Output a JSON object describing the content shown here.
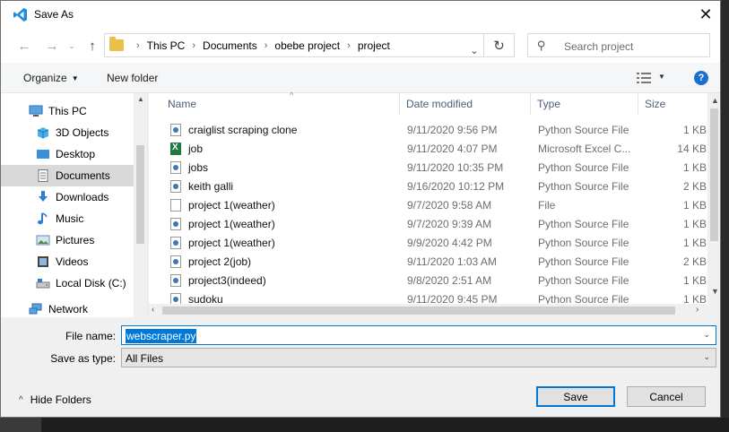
{
  "window": {
    "title": "Save As",
    "close_glyph": "✕"
  },
  "nav": {
    "back_glyph": "←",
    "forward_glyph": "→",
    "up_glyph": "↑",
    "breadcrumb": [
      "This PC",
      "Documents",
      "obebe project",
      "project"
    ],
    "refresh_glyph": "↻",
    "search_placeholder": "Search project"
  },
  "toolbar": {
    "organize": "Organize",
    "new_folder": "New folder",
    "help": "?"
  },
  "sidebar": {
    "items": [
      {
        "label": "This PC",
        "icon": "computer-icon"
      },
      {
        "label": "3D Objects",
        "icon": "3d-objects-icon"
      },
      {
        "label": "Desktop",
        "icon": "desktop-icon"
      },
      {
        "label": "Documents",
        "icon": "documents-icon",
        "selected": true
      },
      {
        "label": "Downloads",
        "icon": "downloads-icon"
      },
      {
        "label": "Music",
        "icon": "music-icon"
      },
      {
        "label": "Pictures",
        "icon": "pictures-icon"
      },
      {
        "label": "Videos",
        "icon": "videos-icon"
      },
      {
        "label": "Local Disk (C:)",
        "icon": "local-disk-icon"
      },
      {
        "label": "Network",
        "icon": "network-icon"
      }
    ]
  },
  "files": {
    "columns": {
      "name": "Name",
      "date": "Date modified",
      "type": "Type",
      "size": "Size"
    },
    "rows": [
      {
        "name": "craiglist scraping clone",
        "date": "9/11/2020 9:56 PM",
        "type": "Python Source File",
        "size": "1 KB",
        "icon": "python-file-icon"
      },
      {
        "name": "job",
        "date": "9/11/2020 4:07 PM",
        "type": "Microsoft Excel C...",
        "size": "14 KB",
        "icon": "excel-file-icon"
      },
      {
        "name": "jobs",
        "date": "9/11/2020 10:35 PM",
        "type": "Python Source File",
        "size": "1 KB",
        "icon": "python-file-icon"
      },
      {
        "name": "keith galli",
        "date": "9/16/2020 10:12 PM",
        "type": "Python Source File",
        "size": "2 KB",
        "icon": "python-file-icon"
      },
      {
        "name": "project 1(weather)",
        "date": "9/7/2020 9:58 AM",
        "type": "File",
        "size": "1 KB",
        "icon": "generic-file-icon"
      },
      {
        "name": "project 1(weather)",
        "date": "9/7/2020 9:39 AM",
        "type": "Python Source File",
        "size": "1 KB",
        "icon": "python-file-icon"
      },
      {
        "name": "project 1(weather)",
        "date": "9/9/2020 4:42 PM",
        "type": "Python Source File",
        "size": "1 KB",
        "icon": "python-file-icon"
      },
      {
        "name": "project 2(job)",
        "date": "9/11/2020 1:03 AM",
        "type": "Python Source File",
        "size": "2 KB",
        "icon": "python-file-icon"
      },
      {
        "name": "project3(indeed)",
        "date": "9/8/2020 2:51 AM",
        "type": "Python Source File",
        "size": "1 KB",
        "icon": "python-file-icon"
      },
      {
        "name": "sudoku",
        "date": "9/11/2020 9:45 PM",
        "type": "Python Source File",
        "size": "1 KB",
        "icon": "python-file-icon"
      }
    ]
  },
  "form": {
    "file_name_label": "File name:",
    "file_name_value": "webscraper.py",
    "save_as_type_label": "Save as type:",
    "save_as_type_value": "All Files"
  },
  "footer": {
    "hide_folders": "Hide Folders",
    "save": "Save",
    "cancel": "Cancel"
  }
}
